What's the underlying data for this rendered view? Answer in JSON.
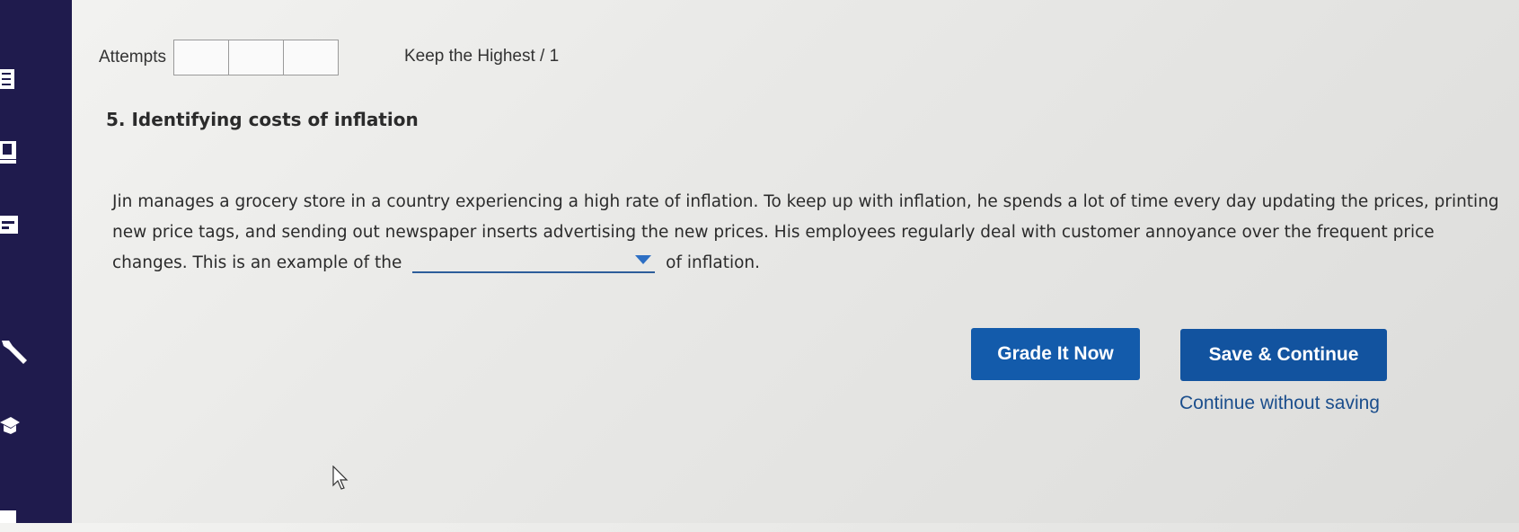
{
  "sidebar": {
    "icons": [
      "list-icon",
      "book-icon",
      "calendar-icon",
      "wrench-icon",
      "graduation-cap-icon",
      "more-icon"
    ]
  },
  "header": {
    "attempts_label": "Attempts",
    "attempt_box_count": 3,
    "keep_label": "Keep the Highest / 1"
  },
  "question": {
    "title": "5. Identifying costs of inflation",
    "body_before": "Jin manages a grocery store in a country experiencing a high rate of inflation. To keep up with inflation, he spends a lot of time every day updating the prices, printing new price tags, and sending out newspaper inserts advertising the new prices. His employees regularly deal with customer annoyance over the frequent price changes. This is an example of the",
    "dropdown_value": "",
    "body_after": "of inflation."
  },
  "actions": {
    "grade_label": "Grade It Now",
    "save_label": "Save & Continue",
    "continue_label": "Continue without saving"
  },
  "colors": {
    "sidebar": "#1f1b4d",
    "button": "#135bab",
    "link": "#1b4e8c"
  }
}
